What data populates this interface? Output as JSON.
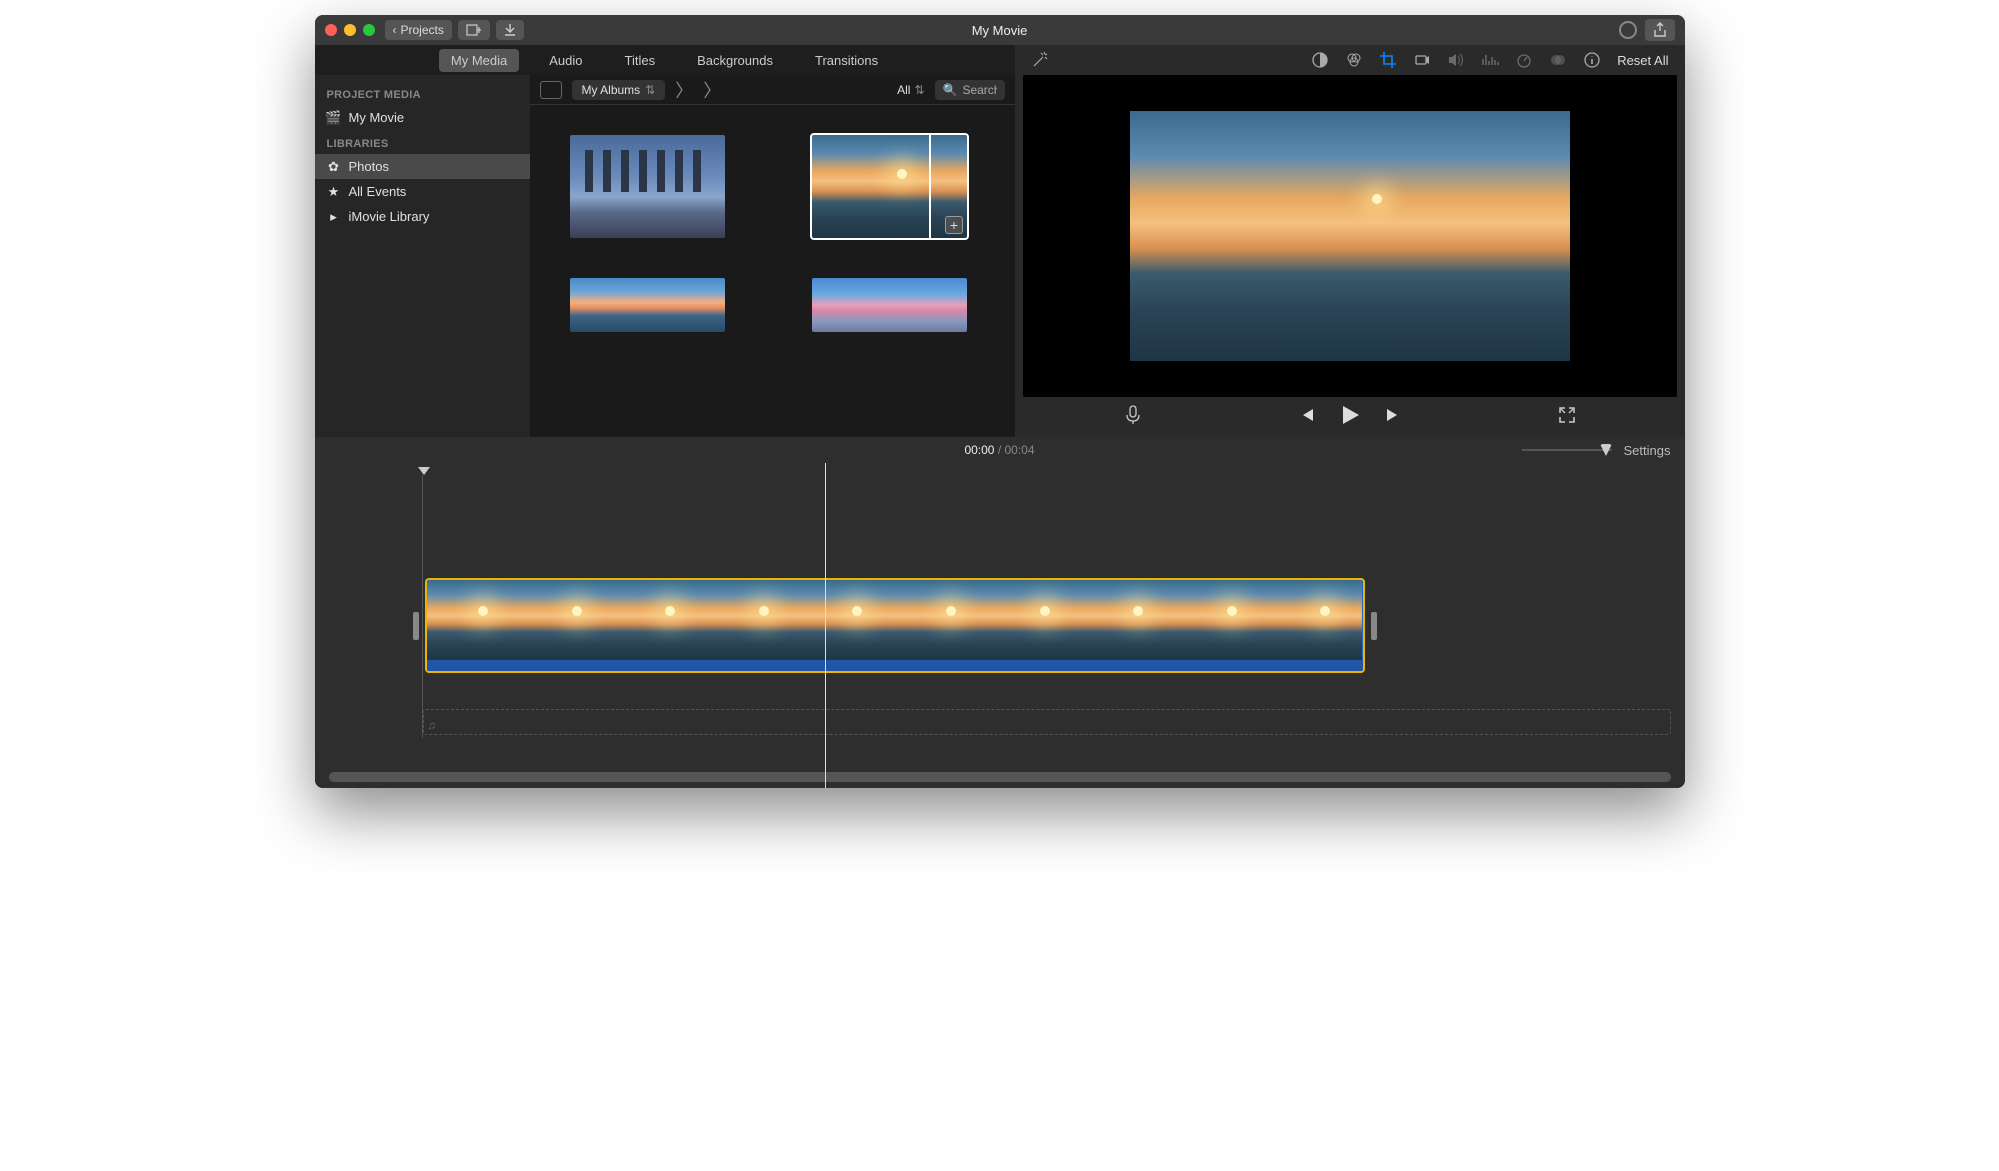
{
  "window": {
    "title": "My Movie"
  },
  "toolbar": {
    "back_label": "Projects"
  },
  "tabs": [
    "My Media",
    "Audio",
    "Titles",
    "Backgrounds",
    "Transitions"
  ],
  "active_tab": "My Media",
  "sidebar": {
    "project_media_head": "PROJECT MEDIA",
    "project_item": "My Movie",
    "libraries_head": "LIBRARIES",
    "items": [
      "Photos",
      "All Events",
      "iMovie Library"
    ],
    "selected": "Photos"
  },
  "browser": {
    "album_label": "My Albums",
    "filter_label": "All",
    "search_placeholder": "Search"
  },
  "inspector": {
    "reset_label": "Reset All"
  },
  "timeline": {
    "current": "00:00",
    "duration": "00:04",
    "settings_label": "Settings"
  }
}
